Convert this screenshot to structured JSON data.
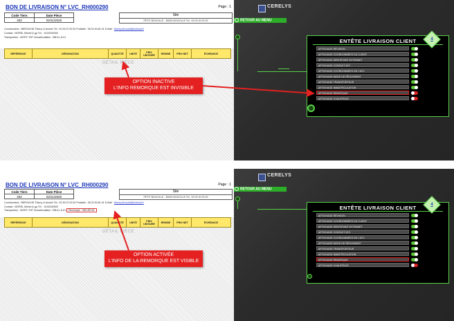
{
  "document": {
    "title": "BON DE LIVRAISON N° LVC_RH000290",
    "page_label": "Page : 1",
    "code_tiers_label": "Code Tiers",
    "date_piece_label": "Date Pièce",
    "code_tiers": "402",
    "date_piece": "02/11/2020",
    "site_label": "Site",
    "site_value": "PETIT BOUVILLE - 35000 BOUVILLE Tel : 09 02 00 00 00",
    "coord_line": "Coordonnées :  BEROUVID Thierry & Annick  Tél :  02.39.37.02.52  Portable :  06.22.94.81.01  E-Mail :",
    "email": "thierry.berouvid@hotmail.fr",
    "contact_line": "Contact :   MOREL Michel & gp  Tél. :  0102040300",
    "transport_line": "Transporteur :   MORY TNT  Immatriculation :  BB-KL-6-01",
    "remorque_text": "Remorque :   360-4RI-61",
    "columns": [
      "RÉFÉRENCE",
      "DÉSIGNATION",
      "QUANTITÉ",
      "UNITÉ",
      "PRIX UNITAIRE",
      "REMISE",
      "PRIX NET",
      "ÉCHÉANCE"
    ],
    "detail_piece": "DÉTAIL PIÈCE"
  },
  "brand": "CERELYS",
  "retour_label": "RETOUR AU MENU",
  "settings_panel": {
    "title": "ENTÊTE LIVRAISON CLIENT",
    "badge": "4",
    "options": [
      "AFFICHAGE RÉVISION",
      "AFFICHAGE COORDONNÉES DU CLIENT",
      "AFFICHAGE IDENTIFIANT EXTRANET",
      "AFFICHAGE CONTACT ATC",
      "AFFICHAGE COORDONNÉES DE L'ATC",
      "AFFICHAGE MODE DE RÈGLEMENT",
      "AFFICHAGE TRANSPORTEUR",
      "AFFICHAGE IMMATRICULATION",
      "AFFICHAGE REMORQUE",
      "AFFICHAGE CHAUFFEUR"
    ],
    "toggles_top": [
      true,
      true,
      true,
      true,
      true,
      true,
      true,
      true,
      false,
      false
    ],
    "toggles_bottom": [
      true,
      true,
      true,
      true,
      true,
      true,
      true,
      true,
      true,
      false
    ],
    "highlighted_option": "AFFICHAGE REMORQUE"
  },
  "callouts": {
    "top": [
      "OPTION INACTIVE",
      "L'INFO REMORQUE EST INVISIBLE"
    ],
    "bottom": [
      "OPTION ACTIVÉE",
      "L'INFO DE LA REMORQUE EST VISIBLE"
    ]
  },
  "colors": {
    "accent_green": "#59d24a",
    "callout_red": "#e42020",
    "title_blue": "#1a35b8",
    "column_yellow": "#ffe86a"
  }
}
